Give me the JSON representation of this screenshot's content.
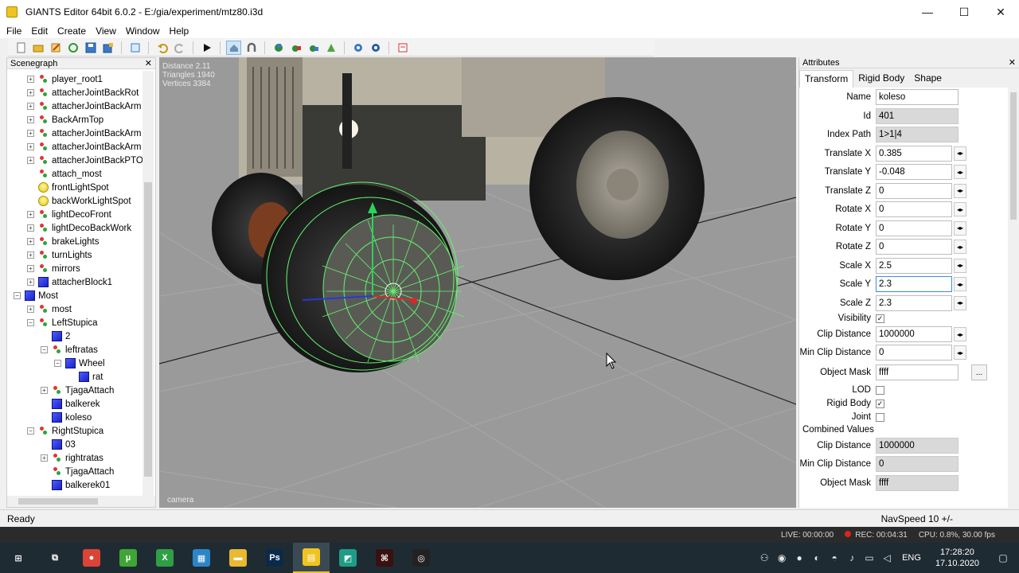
{
  "window": {
    "title": "GIANTS Editor 64bit 6.0.2 - E:/gia/experiment/mtz80.i3d",
    "minimize": "—",
    "maximize": "☐",
    "close": "✕"
  },
  "menu": [
    "File",
    "Edit",
    "Create",
    "View",
    "Window",
    "Help"
  ],
  "scenegraph": {
    "title": "Scenegraph",
    "close": "✕",
    "nodes": [
      {
        "label": "player_root1",
        "icon": "transform",
        "depth": 1,
        "exp": "+"
      },
      {
        "label": "attacherJointBackRot",
        "icon": "transform",
        "depth": 1,
        "exp": "+"
      },
      {
        "label": "attacherJointBackArm",
        "icon": "transform",
        "depth": 1,
        "exp": "+"
      },
      {
        "label": "BackArmTop",
        "icon": "transform",
        "depth": 1,
        "exp": "+"
      },
      {
        "label": "attacherJointBackArm",
        "icon": "transform",
        "depth": 1,
        "exp": "+"
      },
      {
        "label": "attacherJointBackArm",
        "icon": "transform",
        "depth": 1,
        "exp": "+"
      },
      {
        "label": "attacherJointBackPTO",
        "icon": "transform",
        "depth": 1,
        "exp": "+"
      },
      {
        "label": "attach_most",
        "icon": "transform",
        "depth": 1,
        "exp": ""
      },
      {
        "label": "frontLightSpot",
        "icon": "light",
        "depth": 1,
        "exp": ""
      },
      {
        "label": "backWorkLightSpot",
        "icon": "light",
        "depth": 1,
        "exp": ""
      },
      {
        "label": "lightDecoFront",
        "icon": "transform",
        "depth": 1,
        "exp": "+"
      },
      {
        "label": "lightDecoBackWork",
        "icon": "transform",
        "depth": 1,
        "exp": "+"
      },
      {
        "label": "brakeLights",
        "icon": "transform",
        "depth": 1,
        "exp": "+"
      },
      {
        "label": "turnLights",
        "icon": "transform",
        "depth": 1,
        "exp": "+"
      },
      {
        "label": "mirrors",
        "icon": "transform",
        "depth": 1,
        "exp": "+"
      },
      {
        "label": "attacherBlock1",
        "icon": "cube",
        "depth": 1,
        "exp": "+"
      },
      {
        "label": "Most",
        "icon": "cube",
        "depth": 0,
        "exp": "−"
      },
      {
        "label": "most",
        "icon": "transform",
        "depth": 1,
        "exp": "+"
      },
      {
        "label": "LeftStupica",
        "icon": "transform",
        "depth": 1,
        "exp": "−"
      },
      {
        "label": "2",
        "icon": "cube",
        "depth": 2,
        "exp": ""
      },
      {
        "label": "leftratas",
        "icon": "transform",
        "depth": 2,
        "exp": "−"
      },
      {
        "label": "Wheel",
        "icon": "cube",
        "depth": 3,
        "exp": "−"
      },
      {
        "label": "rat",
        "icon": "cube",
        "depth": 4,
        "exp": ""
      },
      {
        "label": "TjagaAttach",
        "icon": "transform",
        "depth": 2,
        "exp": "+"
      },
      {
        "label": "balkerek",
        "icon": "cube",
        "depth": 2,
        "exp": ""
      },
      {
        "label": "koleso",
        "icon": "cube",
        "depth": 2,
        "exp": ""
      },
      {
        "label": "RightStupica",
        "icon": "transform",
        "depth": 1,
        "exp": "−"
      },
      {
        "label": "03",
        "icon": "cube",
        "depth": 2,
        "exp": ""
      },
      {
        "label": "rightratas",
        "icon": "transform",
        "depth": 2,
        "exp": "+"
      },
      {
        "label": "TjagaAttach",
        "icon": "transform",
        "depth": 2,
        "exp": ""
      },
      {
        "label": "balkerek01",
        "icon": "cube",
        "depth": 2,
        "exp": ""
      }
    ]
  },
  "viewport": {
    "stats": [
      "Distance 2.11",
      "Triangles 1940",
      "Vertices 3384"
    ],
    "camera": "camera"
  },
  "attributes": {
    "title": "Attributes",
    "close": "✕",
    "tabs": [
      "Transform",
      "Rigid Body",
      "Shape"
    ],
    "rows": [
      {
        "label": "Name",
        "value": "koleso",
        "kind": "text"
      },
      {
        "label": "Id",
        "value": "401",
        "kind": "readonly"
      },
      {
        "label": "Index Path",
        "value": "1>1|4",
        "kind": "readonly"
      },
      {
        "label": "Translate X",
        "value": "0.385",
        "kind": "spin"
      },
      {
        "label": "Translate Y",
        "value": "-0.048",
        "kind": "spin"
      },
      {
        "label": "Translate Z",
        "value": "0",
        "kind": "spin"
      },
      {
        "label": "Rotate X",
        "value": "0",
        "kind": "spin"
      },
      {
        "label": "Rotate Y",
        "value": "0",
        "kind": "spin"
      },
      {
        "label": "Rotate Z",
        "value": "0",
        "kind": "spin"
      },
      {
        "label": "Scale X",
        "value": "2.5",
        "kind": "spin"
      },
      {
        "label": "Scale Y",
        "value": "2.3",
        "kind": "spin-focus"
      },
      {
        "label": "Scale Z",
        "value": "2.3",
        "kind": "spin"
      }
    ],
    "visibility": {
      "label": "Visibility",
      "checked": true
    },
    "clip_distance": {
      "label": "Clip Distance",
      "value": "1000000"
    },
    "min_clip_distance": {
      "label": "Min Clip Distance",
      "value": "0"
    },
    "object_mask": {
      "label": "Object Mask",
      "value": "ffff",
      "button": "..."
    },
    "lod": {
      "label": "LOD",
      "checked": false
    },
    "rigid_body": {
      "label": "Rigid Body",
      "checked": true
    },
    "joint": {
      "label": "Joint",
      "checked": false
    },
    "combined": {
      "title": "Combined Values",
      "clip_label": "Clip Distance",
      "clip_value": "1000000",
      "min_clip_label": "Min Clip Distance",
      "min_clip_value": "0",
      "mask_label": "Object Mask",
      "mask_value": "ffff"
    }
  },
  "status": {
    "left": "Ready",
    "right": "NavSpeed 10 +/-"
  },
  "recorder": {
    "live": "LIVE: 00:00:00",
    "rec": "REC: 00:04:31",
    "cpu": "CPU: 0.8%, 30.00 fps"
  },
  "taskbar": {
    "apps": [
      {
        "name": "start",
        "glyph": "⊞",
        "color": "transparent"
      },
      {
        "name": "task-view",
        "glyph": "⧉",
        "color": "transparent"
      },
      {
        "name": "chrome",
        "glyph": "●",
        "color": "#db4437"
      },
      {
        "name": "utorrent",
        "glyph": "µ",
        "color": "#3fa535"
      },
      {
        "name": "xbox",
        "glyph": "X",
        "color": "#2f9e44"
      },
      {
        "name": "store",
        "glyph": "▦",
        "color": "#2b86c7"
      },
      {
        "name": "explorer",
        "glyph": "▬",
        "color": "#e8b931"
      },
      {
        "name": "photoshop",
        "glyph": "Ps",
        "color": "#0b2a4a"
      },
      {
        "name": "giants-editor",
        "glyph": "▤",
        "color": "#f0c420"
      },
      {
        "name": "app-green",
        "glyph": "◩",
        "color": "#1d9d87"
      },
      {
        "name": "app-dark",
        "glyph": "⌘",
        "color": "#3a1010"
      },
      {
        "name": "obs",
        "glyph": "◎",
        "color": "#222"
      }
    ],
    "lang": "ENG",
    "time": "17:28:20",
    "date": "17.10.2020"
  },
  "colors": {
    "viewport_bg": "#9a9a9a",
    "wireframe": "#63f56e",
    "accent": "#3b8ee0"
  }
}
